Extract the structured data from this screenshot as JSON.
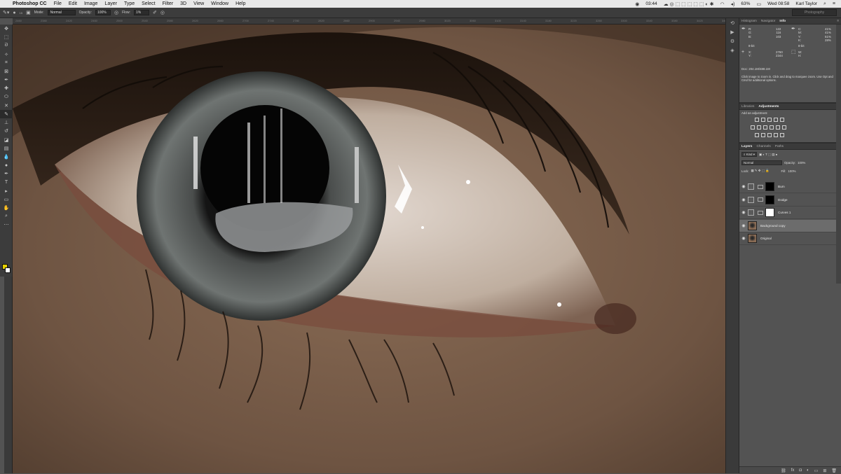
{
  "menubar": {
    "app_name": "Photoshop CC",
    "items": [
      "File",
      "Edit",
      "Image",
      "Layer",
      "Type",
      "Select",
      "Filter",
      "3D",
      "View",
      "Window",
      "Help"
    ],
    "time": "03:44",
    "battery": "63%",
    "datetime": "Wed 08:58",
    "user": "Karl Taylor"
  },
  "options": {
    "mode_label": "Mode:",
    "mode_value": "Normal",
    "opacity_label": "Opacity:",
    "opacity_value": "100%",
    "flow_label": "Flow:",
    "flow_value": "1%",
    "brush_size": "15",
    "workspace": "Photography"
  },
  "ruler": {
    "ticks": [
      "2460",
      "2380",
      "2420",
      "2460",
      "2500",
      "2540",
      "2580",
      "2620",
      "2660",
      "2700",
      "2740",
      "2780",
      "2820",
      "2860",
      "2900",
      "2940",
      "2980",
      "3020",
      "3060",
      "3100",
      "3140",
      "3180",
      "3220",
      "3260",
      "3300",
      "3340",
      "3380",
      "3420",
      "3460",
      "3500"
    ]
  },
  "panels": {
    "info_tabs": [
      "Histogram",
      "Navigator",
      "Info"
    ],
    "info": {
      "rgb_labels": [
        "R:",
        "G:",
        "B:"
      ],
      "rgb_values": [
        "122",
        "116",
        "103"
      ],
      "cmyk_labels": [
        "C:",
        "M:",
        "Y:",
        "K:"
      ],
      "cmyk_values": [
        "41%",
        "41%",
        "51%",
        "28%"
      ],
      "bit_left": "8-bit",
      "bit_right": "8-bit",
      "xy_labels": [
        "X:",
        "Y:"
      ],
      "xy_values": [
        "2760",
        "2344"
      ],
      "wh_labels": [
        "W:",
        "H:"
      ],
      "doc": "Doc: 204.1M/488.1M",
      "note": "Click image to zoom in. Click and drag to marquee zoom. Use Opt and Cmd for additional options."
    },
    "adj_tabs": [
      "Libraries",
      "Adjustments"
    ],
    "adj_label": "Add an adjustment",
    "layers_tabs": [
      "Layers",
      "Channels",
      "Paths"
    ],
    "kind": "Kind",
    "blend": "Normal",
    "opacity_label": "Opacity:",
    "opacity": "100%",
    "lock_label": "Lock:",
    "fill_label": "Fill:",
    "fill": "100%",
    "layers": [
      {
        "name": "Burn",
        "type": "mask-dark"
      },
      {
        "name": "Dodge",
        "type": "mask-dark"
      },
      {
        "name": "Curves 1",
        "type": "mask-light"
      },
      {
        "name": "Background copy",
        "type": "image"
      },
      {
        "name": "Original",
        "type": "image"
      }
    ]
  },
  "colors": {
    "foreground": "#e6d000",
    "background": "#ffffff",
    "selected_layer": "#6c6c6c"
  }
}
